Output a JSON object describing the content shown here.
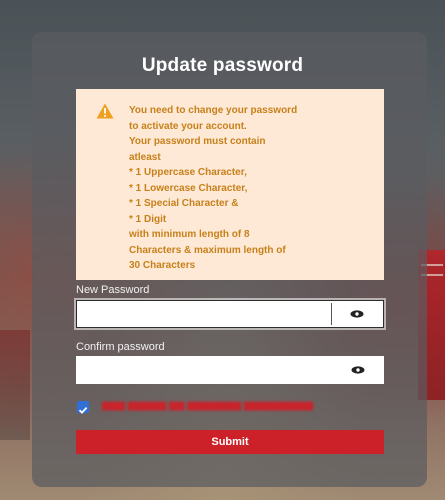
{
  "title": "Update password",
  "alert": {
    "icon": "warning-icon",
    "lines": [
      "You need to change your password",
      "to activate your account.",
      "Your password must contain",
      "atleast",
      "* 1 Uppercase Character,",
      "* 1 Lowercase Character,",
      "* 1 Special Character &",
      "* 1 Digit",
      "with minimum length of 8",
      "Characters & maximum length of",
      "30 Characters"
    ],
    "colors": {
      "background": "#fde9d6",
      "text": "#c8801a",
      "icon": "#f0a020"
    }
  },
  "new_password": {
    "label": "New Password",
    "value": "",
    "placeholder": "",
    "toggle_icon": "eye-icon"
  },
  "confirm_password": {
    "label": "Confirm password",
    "value": "",
    "placeholder": "",
    "toggle_icon": "eye-icon"
  },
  "remember": {
    "checked": true
  },
  "submit": {
    "label": "Submit"
  },
  "colors": {
    "accent": "#cc2129",
    "checkbox": "#2f6fd6"
  }
}
